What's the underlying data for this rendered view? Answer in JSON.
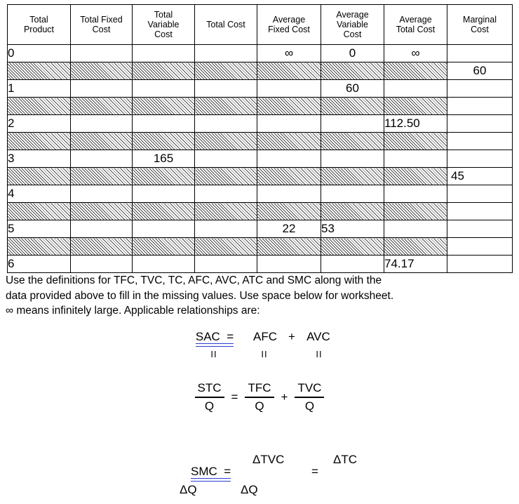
{
  "table": {
    "headers": [
      "Total Product",
      "Total Fixed Cost",
      "Total Variable Cost",
      "Total Cost",
      "Average Fixed Cost",
      "Average Variable Cost",
      "Average Total Cost",
      "Marginal Cost"
    ],
    "header_lines": [
      [
        "Total",
        "Product"
      ],
      [
        "Total Fixed",
        "Cost"
      ],
      [
        "Total",
        "Variable",
        "Cost"
      ],
      [
        "Total Cost"
      ],
      [
        "Average",
        "Fixed Cost"
      ],
      [
        "Average",
        "Variable",
        "Cost"
      ],
      [
        "Average",
        "Total Cost"
      ],
      [
        "Marginal",
        "Cost"
      ]
    ],
    "product_rows": [
      {
        "total_product": "0",
        "total_fixed_cost": "",
        "total_variable_cost": "",
        "total_cost": "",
        "average_fixed_cost": "∞",
        "average_variable_cost": "0",
        "average_total_cost": "∞"
      },
      {
        "total_product": "1",
        "total_fixed_cost": "",
        "total_variable_cost": "",
        "total_cost": "",
        "average_fixed_cost": "",
        "average_variable_cost": "60",
        "average_total_cost": ""
      },
      {
        "total_product": "2",
        "total_fixed_cost": "",
        "total_variable_cost": "",
        "total_cost": "",
        "average_fixed_cost": "",
        "average_variable_cost": "",
        "average_total_cost": "112.50"
      },
      {
        "total_product": "3",
        "total_fixed_cost": "",
        "total_variable_cost": "165",
        "total_cost": "",
        "average_fixed_cost": "",
        "average_variable_cost": "",
        "average_total_cost": ""
      },
      {
        "total_product": "4",
        "total_fixed_cost": "",
        "total_variable_cost": "",
        "total_cost": "",
        "average_fixed_cost": "",
        "average_variable_cost": "",
        "average_total_cost": ""
      },
      {
        "total_product": "5",
        "total_fixed_cost": "",
        "total_variable_cost": "",
        "total_cost": "",
        "average_fixed_cost": "22",
        "average_variable_cost": "53",
        "average_total_cost": ""
      },
      {
        "total_product": "6",
        "total_fixed_cost": "",
        "total_variable_cost": "",
        "total_cost": "",
        "average_fixed_cost": "",
        "average_variable_cost": "",
        "average_total_cost": "74.17"
      }
    ],
    "marginal_cost_rows": [
      "60",
      "",
      "",
      "45",
      "",
      ""
    ]
  },
  "instructions": {
    "line1": "Use the definitions for TFC, TVC, TC, AFC, AVC, ATC and SMC along with the",
    "line2": "data provided above to fill in the missing values.  Use space below for worksheet.",
    "line3": "∞ means infinitely large.  Applicable relationships are:"
  },
  "formulas": {
    "sac": {
      "lhs": "SAC  =",
      "term1": "AFC",
      "plus": "+",
      "term2": "AVC",
      "eq_mark1": "II",
      "eq_mark2": "II",
      "eq_mark3": "II"
    },
    "stc": {
      "num1": "STC",
      "den1": "Q",
      "eq": "=",
      "num2": "TFC",
      "den2": "Q",
      "plus": "+",
      "num3": "TVC",
      "den3": "Q"
    },
    "smc": {
      "label": "SMC  =",
      "label_den": "ΔQ",
      "num1": "ΔTVC",
      "den1": "ΔQ",
      "eq": "=",
      "num2": "ΔTC"
    }
  },
  "colors": {
    "underline_blue": "#2a3fd4",
    "rule_black": "#000000",
    "page_background": "#ffffff"
  }
}
